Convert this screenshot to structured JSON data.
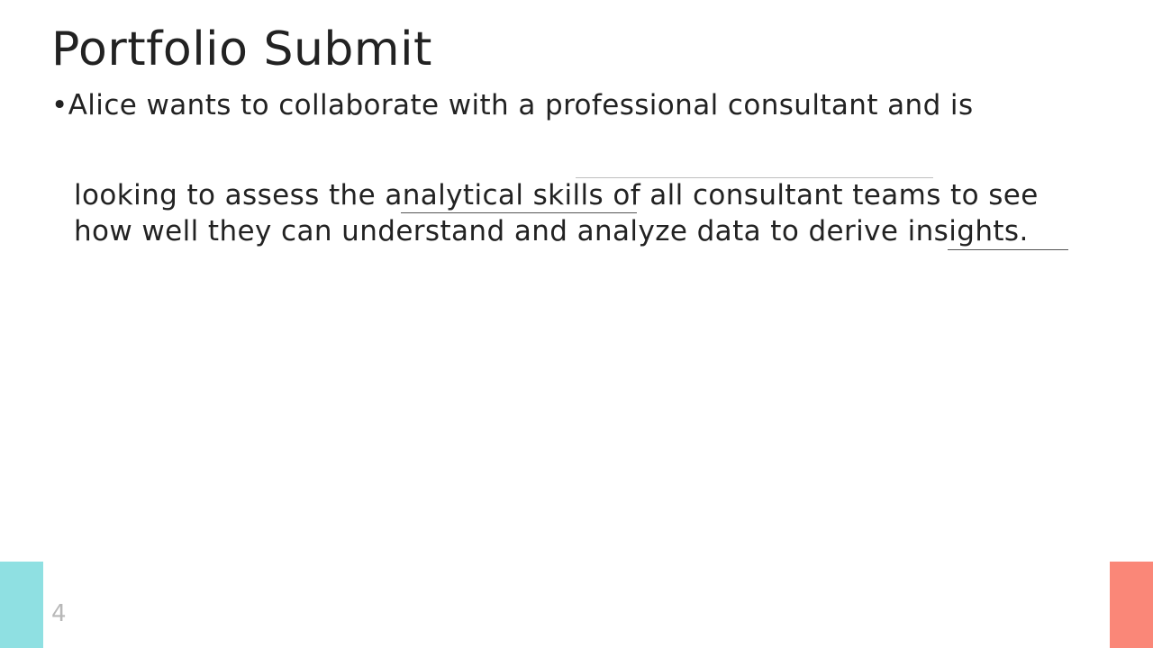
{
  "slide": {
    "title": "Portfolio Submit",
    "bullet_marker": "•",
    "bullet_line1": "Alice wants to collaborate with a professional consultant and is",
    "bullet_line2": "looking to assess the analytical skills of all consultant teams to see",
    "bullet_line3": "how well they can understand and analyze data to derive insights.",
    "page_number": "4"
  },
  "colors": {
    "text": "#222222",
    "accent_left": "#8fe0e2",
    "accent_right": "#fa8778",
    "page_number": "#b8b8b8"
  }
}
